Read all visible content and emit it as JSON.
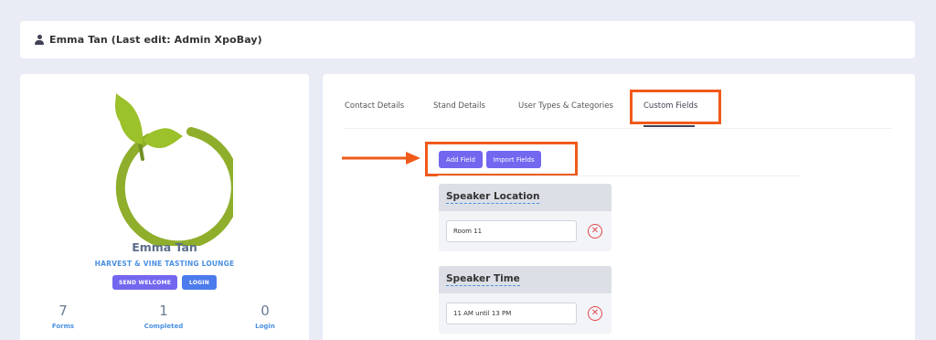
{
  "header": {
    "icon": "user-icon",
    "title": "Emma Tan (Last edit: Admin XpoBay)"
  },
  "profile": {
    "logo": "leaf-circle-logo",
    "name": "Emma Tan",
    "company": "HARVEST & VINE TASTING LOUNGE",
    "send_welcome_label": "SEND WELCOME",
    "login_label": "LOGIN",
    "stats": [
      {
        "value": "7",
        "label": "Forms"
      },
      {
        "value": "1",
        "label": "Completed"
      },
      {
        "value": "0",
        "label": "Login"
      }
    ]
  },
  "tabs": [
    {
      "label": "Contact Details"
    },
    {
      "label": "Stand Details"
    },
    {
      "label": "User Types & Categories"
    },
    {
      "label": "Custom Fields",
      "active": true
    }
  ],
  "toolbar": {
    "add_field_label": "Add Field",
    "import_fields_label": "Import Fields"
  },
  "custom_fields": [
    {
      "title": "Speaker Location",
      "value": "Room 11"
    },
    {
      "title": "Speaker Time",
      "value": "11 AM until 13 PM"
    }
  ],
  "colors": {
    "background": "#e9ebf5",
    "primary_purple": "#7367f0",
    "login_blue": "#4b7bec",
    "link_blue": "#4a90e2",
    "annotation_orange": "#f05a1a",
    "remove_red": "#e5484d",
    "leaf_green": "#9bc12b"
  }
}
